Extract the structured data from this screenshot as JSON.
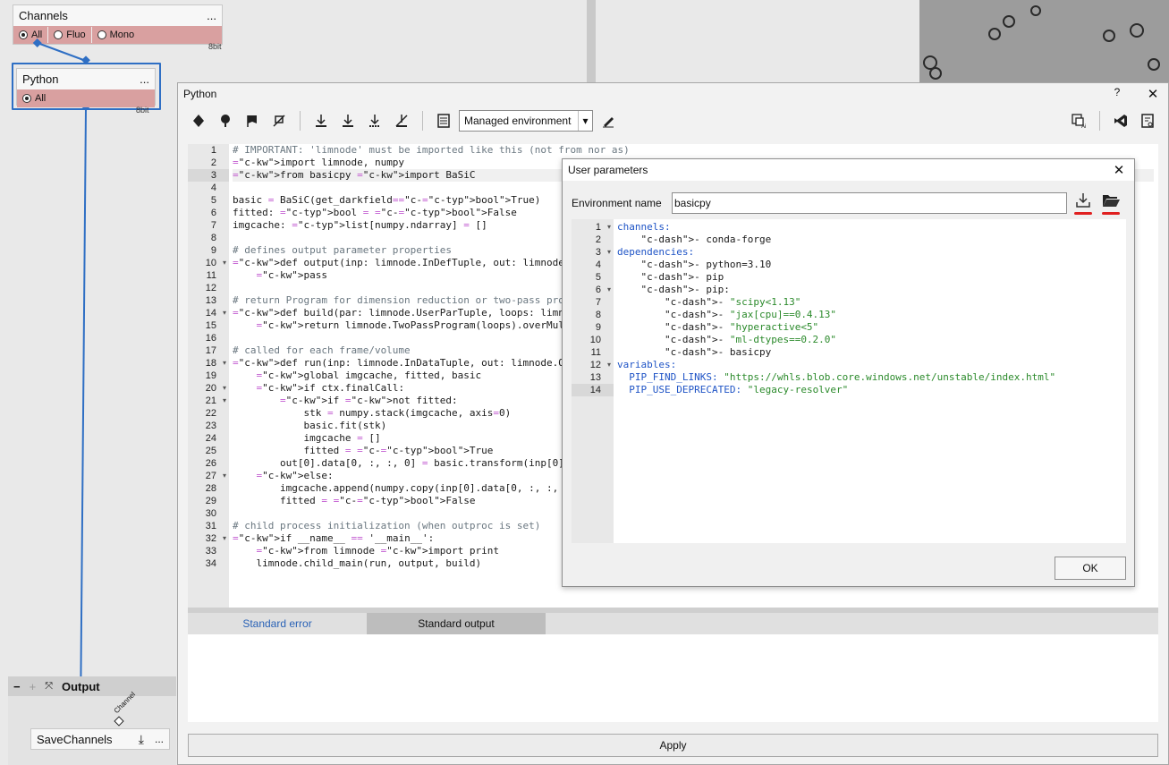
{
  "graph": {
    "channels_node": {
      "title": "Channels",
      "menu": "...",
      "options": [
        "All",
        "Fluo",
        "Mono"
      ],
      "selected": "All",
      "bits": "8bit"
    },
    "python_node": {
      "title": "Python",
      "menu": "...",
      "option": "All",
      "bits": "8bit"
    },
    "output_panel": {
      "title": "Output",
      "node_label": "SaveChannels",
      "menu": "...",
      "port_label": "Channel"
    }
  },
  "python_window": {
    "title": "Python",
    "help": "?",
    "close": "✕",
    "env_select": "Managed environment",
    "code_lines": [
      "# IMPORTANT: 'limnode' must be imported like this (not from nor as)",
      "import limnode, numpy",
      "from basicpy import BaSiC",
      "",
      "basic = BaSiC(get_darkfield=True)",
      "fitted: bool = False",
      "imgcache: list[numpy.ndarray] = []",
      "",
      "# defines output parameter properties",
      "def output(inp: limnode.InDefTuple, out: limnode.OutDefT",
      "    pass",
      "",
      "# return Program for dimension reduction or two-pass pro",
      "def build(par: limnode.UserParTuple, loops: limnode.Loop",
      "    return limnode.TwoPassProgram(loops).overMultiPoint()",
      "",
      "# called for each frame/volume",
      "def run(inp: limnode.InDataTuple, out: limnode.OutDataTu",
      "    global imgcache, fitted, basic",
      "    if ctx.finalCall:",
      "        if not fitted:",
      "            stk = numpy.stack(imgcache, axis=0)",
      "            basic.fit(stk)",
      "            imgcache = []",
      "            fitted = True",
      "        out[0].data[0, :, :, 0] = basic.transform(inp[0].",
      "    else:",
      "        imgcache.append(numpy.copy(inp[0].data[0, :, :, 0",
      "        fitted = False",
      "",
      "# child process initialization (when outproc is set)",
      "if __name__ == '__main__':",
      "    from limnode import print",
      "    limnode.child_main(run, output, build)"
    ],
    "tabs": [
      "Standard error",
      "Standard output"
    ],
    "active_tab": "Standard output",
    "apply": "Apply"
  },
  "dialog": {
    "title": "User parameters",
    "close": "✕",
    "env_label": "Environment name",
    "env_value": "basicpy",
    "yaml_lines": [
      "channels:",
      "    - conda-forge",
      "dependencies:",
      "    - python=3.10",
      "    - pip",
      "    - pip:",
      "        - \"scipy<1.13\"",
      "        - \"jax[cpu]==0.4.13\"",
      "        - \"hyperactive<5\"",
      "        - \"ml-dtypes==0.2.0\"",
      "        - basicpy",
      "variables:",
      "  PIP_FIND_LINKS: \"https://whls.blob.core.windows.net/unstable/index.html\"",
      "  PIP_USE_DEPRECATED: \"legacy-resolver\""
    ],
    "ok": "OK"
  }
}
